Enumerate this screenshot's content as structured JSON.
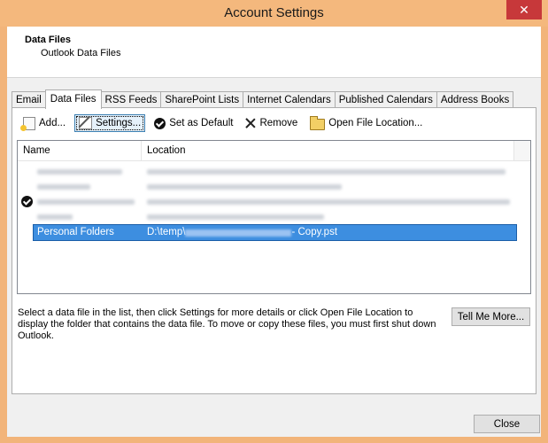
{
  "window": {
    "title": "Account Settings",
    "close_glyph": "✕"
  },
  "header": {
    "title": "Data Files",
    "subtitle": "Outlook Data Files"
  },
  "tabs": [
    {
      "label": "Email"
    },
    {
      "label": "Data Files"
    },
    {
      "label": "RSS Feeds"
    },
    {
      "label": "SharePoint Lists"
    },
    {
      "label": "Internet Calendars"
    },
    {
      "label": "Published Calendars"
    },
    {
      "label": "Address Books"
    }
  ],
  "toolbar": {
    "add": {
      "label": "Add...",
      "icon": "add-file-icon"
    },
    "settings": {
      "label": "Settings...",
      "icon": "settings-icon"
    },
    "default": {
      "label": "Set as Default",
      "icon": "check-circle-icon"
    },
    "remove": {
      "label": "Remove",
      "icon": "x-icon"
    },
    "open": {
      "label": "Open File Location...",
      "icon": "folder-icon"
    }
  },
  "list": {
    "columns": {
      "name": "Name",
      "location": "Location"
    },
    "selected_row": {
      "name": "Personal Folders",
      "location_prefix": "D:\\temp\\",
      "location_suffix": " - Copy.pst"
    }
  },
  "description": "Select a data file in the list, then click Settings for more details or click Open File Location to display the folder that contains the data file. To move or copy these files, you must first shut down Outlook.",
  "buttons": {
    "tell_me_more": "Tell Me More...",
    "close": "Close"
  }
}
